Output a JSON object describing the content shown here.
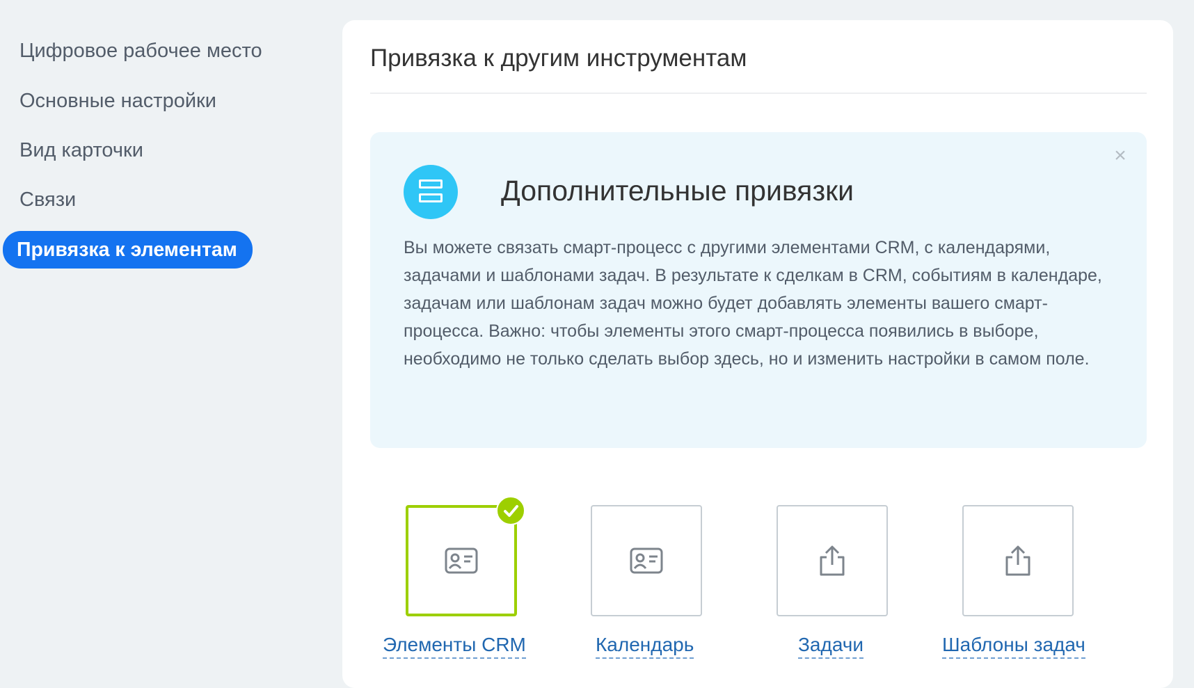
{
  "sidebar": {
    "items": [
      {
        "label": "Цифровое рабочее место"
      },
      {
        "label": "Основные настройки"
      },
      {
        "label": "Вид карточки"
      },
      {
        "label": "Связи"
      },
      {
        "label": "Привязка к элементам",
        "active": true
      }
    ]
  },
  "panel": {
    "title": "Привязка к другим инструментам",
    "info": {
      "icon": "list-layout-icon",
      "title": "Дополнительные привязки",
      "text": "Вы можете связать смарт-процесс с другими элементами CRM, с календарями, задачами и шаблонами задач. В результате к сделкам в CRM, событиям в календаре, задачам или шаблонам задач можно будет добавлять элементы вашего смарт-процесса. Важно: чтобы элементы этого смарт-процесса появились в выборе, необходимо не только сделать выбор здесь, но и изменить настройки в самом поле."
    },
    "options": [
      {
        "label": "Элементы CRM",
        "icon": "contact-card-icon",
        "selected": true
      },
      {
        "label": "Календарь",
        "icon": "contact-card-icon",
        "selected": false
      },
      {
        "label": "Задачи",
        "icon": "share-icon",
        "selected": false
      },
      {
        "label": "Шаблоны задач",
        "icon": "share-icon",
        "selected": false
      }
    ]
  },
  "colors": {
    "accent": "#1473f0",
    "selected": "#9dcf00",
    "info_bg": "#ecf7fc",
    "icon_bg": "#2fc6f6",
    "link": "#2067b0"
  }
}
